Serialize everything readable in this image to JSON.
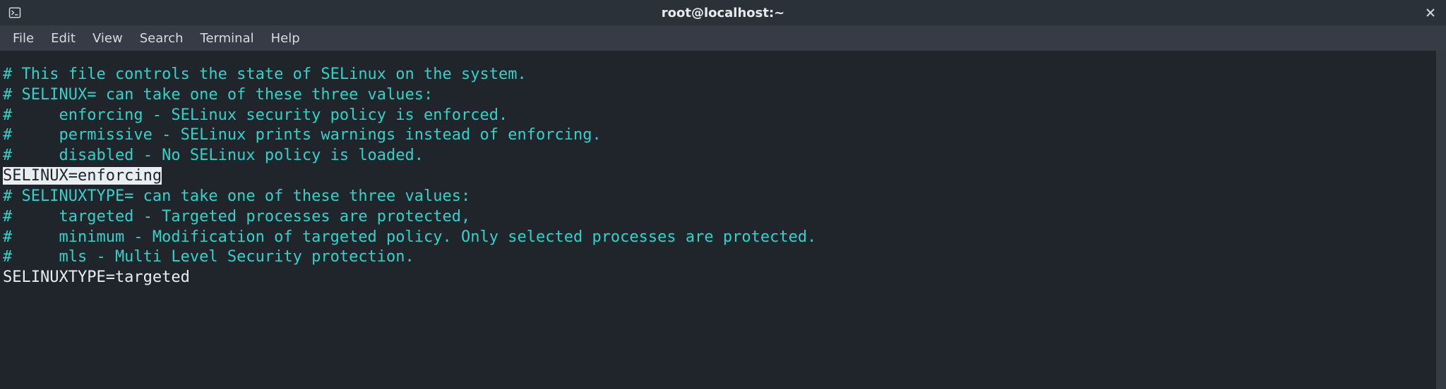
{
  "window": {
    "title": "root@localhost:~"
  },
  "menu": {
    "file": "File",
    "edit": "Edit",
    "view": "View",
    "search": "Search",
    "terminal": "Terminal",
    "help": "Help"
  },
  "content": {
    "l1": "# This file controls the state of SELinux on the system.",
    "l2": "# SELINUX= can take one of these three values:",
    "l3": "#     enforcing - SELinux security policy is enforced.",
    "l4": "#     permissive - SELinux prints warnings instead of enforcing.",
    "l5": "#     disabled - No SELinux policy is loaded.",
    "l6_hl": "SELINUX=enforcin",
    "l6_cursor": "g",
    "l7": "# SELINUXTYPE= can take one of these three values:",
    "l8": "#     targeted - Targeted processes are protected,",
    "l9": "#     minimum - Modification of targeted policy. Only selected processes are protected.",
    "l10": "#     mls - Multi Level Security protection.",
    "l11": "SELINUXTYPE=targeted"
  },
  "colors": {
    "comment": "#32d2c9",
    "fg": "#e9eef2",
    "bg_terminal": "#1f252b",
    "bg_chrome": "#2b3138",
    "bg_menubar": "#353c45"
  }
}
